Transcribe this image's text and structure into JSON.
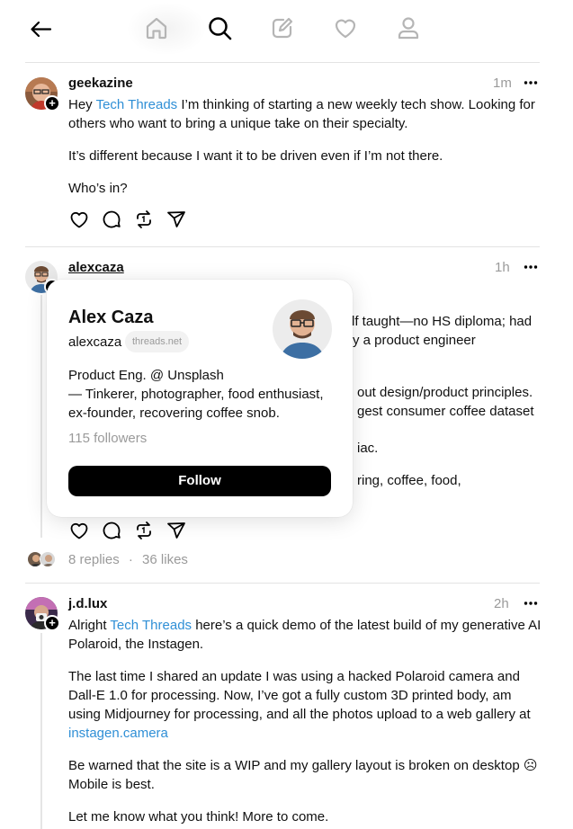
{
  "nav": {
    "items": [
      "back-icon",
      "home-icon",
      "search-icon",
      "compose-icon",
      "heart-icon",
      "profile-icon"
    ]
  },
  "posts": [
    {
      "username": "geekazine",
      "time": "1m",
      "mention": "Tech Threads",
      "p1_pre": "Hey ",
      "p1_post": " I’m thinking of starting a new weekly tech show. Looking for others who want to bring a unique take on their specialty.",
      "p2": "It’s different because I want it to be driven even if I’m not there.",
      "p3": "Who’s in?"
    },
    {
      "username": "alexcaza",
      "time": "1h",
      "visible_lines": [
        "lf taught—no HS diploma; had",
        "y a product engineer",
        "out design/product principles.",
        "gest consumer coffee dataset",
        "iac.",
        "ring, coffee, food,"
      ],
      "replies": "8 replies",
      "separator": "·",
      "likes": "36 likes"
    },
    {
      "username": "j.d.lux",
      "time": "2h",
      "mention": "Tech Threads",
      "p1_pre": "Alright ",
      "p1_post": " here’s a quick demo of the latest build of my generative AI Polaroid, the Instagen.",
      "p2_pre": "The last time I shared an update I was using a hacked Polaroid camera and Dall-E 1.0 for processing. Now, I’ve got a fully custom 3D printed body, am using Midjourney for processing, and all the photos upload to a web gallery at ",
      "p2_link": "instagen.camera",
      "p3": "Be warned that the site is a WIP and my gallery layout is broken on desktop ☹ Mobile is best.",
      "p4": "Let me know what you think! More to come."
    }
  ],
  "popover": {
    "name": "Alex Caza",
    "handle": "alexcaza",
    "domain": "threads.net",
    "bio_line1": "Product Eng. @ Unsplash",
    "bio_line2": "— Tinkerer, photographer, food enthusiast, ex-founder, recovering coffee snob.",
    "followers": "115 followers",
    "follow_label": "Follow"
  },
  "colors": {
    "mention": "#2f8fd6",
    "muted": "#9a9a9a",
    "text": "#101010"
  }
}
